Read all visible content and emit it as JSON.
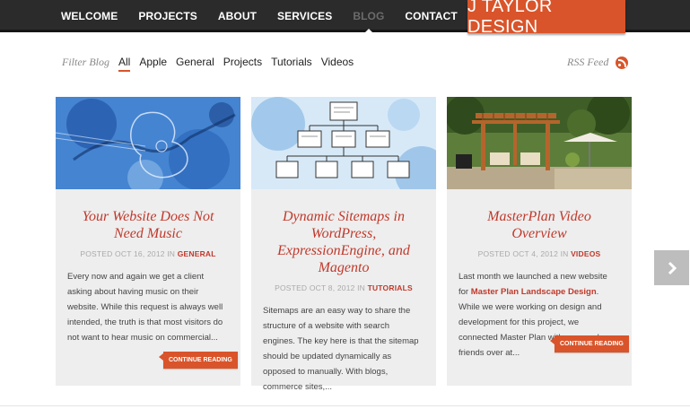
{
  "nav": {
    "items": [
      {
        "label": "WELCOME"
      },
      {
        "label": "PROJECTS"
      },
      {
        "label": "ABOUT"
      },
      {
        "label": "SERVICES"
      },
      {
        "label": "BLOG"
      },
      {
        "label": "CONTACT"
      }
    ],
    "active": "BLOG",
    "logo_text": "J TAYLOR DESIGN"
  },
  "filter": {
    "label": "Filter Blog",
    "items": [
      {
        "label": "All"
      },
      {
        "label": "Apple"
      },
      {
        "label": "General"
      },
      {
        "label": "Projects"
      },
      {
        "label": "Tutorials"
      },
      {
        "label": "Videos"
      }
    ],
    "active": "All"
  },
  "rss": {
    "label": "RSS Feed",
    "icon": "rss-icon"
  },
  "posts": [
    {
      "title": "Your Website Does Not Need Music",
      "meta_prefix": "POSTED OCT 16, 2012 IN ",
      "category": "GENERAL",
      "excerpt": "Every now and again we get a client asking about having music on their website. While this request is always well intended, the truth is that most visitors do not want to hear music on commercial...",
      "button": "CONTINUE READING",
      "image": "guitar-illustration"
    },
    {
      "title": "Dynamic Sitemaps in WordPress, ExpressionEngine, and Magento",
      "meta_prefix": "POSTED OCT 8, 2012 IN ",
      "category": "TUTORIALS",
      "excerpt": "Sitemaps are an easy way to share the structure of a website with search engines. The key here is that the sitemap should be updated dynamically as opposed to manually. With blogs, commerce sites,...",
      "image": "sitemap-sketch"
    },
    {
      "title": "MasterPlan Video Overview",
      "meta_prefix": "POSTED OCT 4, 2012 IN ",
      "category": "VIDEOS",
      "excerpt_before": "Last month we launched a new website for ",
      "excerpt_link": "Master Plan Landscape Design",
      "excerpt_after": ". While we were working on design and development for this project, we connected Master Plan with our good friends over at...",
      "button": "CONTINUE READING",
      "image": "pergola-photo"
    }
  ],
  "controls": {
    "next_icon": "chevron-right-icon"
  },
  "colors": {
    "accent": "#d9542a",
    "nav_bg": "#2b2b2b",
    "card_bg": "#eeeeee",
    "title_red": "#c0392b"
  }
}
